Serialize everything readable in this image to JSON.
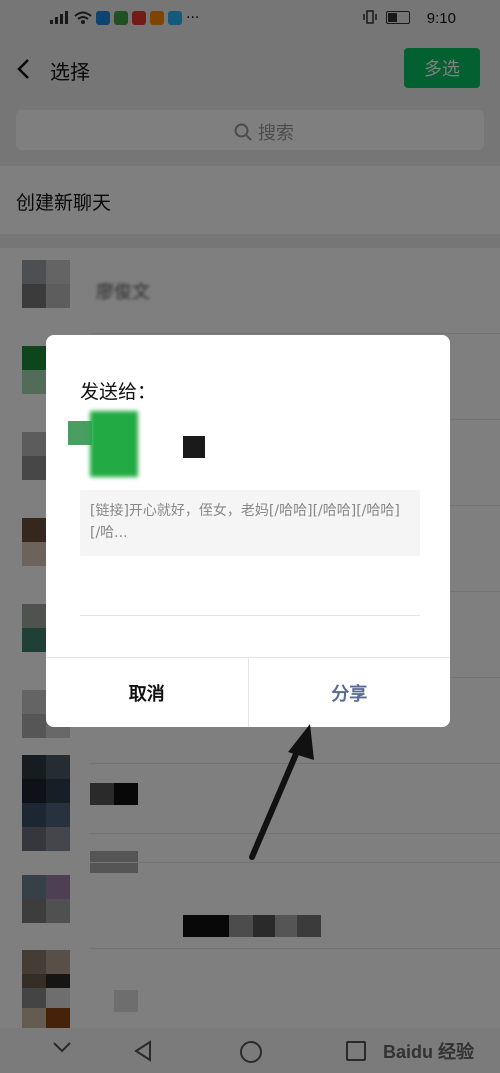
{
  "status_bar": {
    "time": "9:10",
    "more": "···"
  },
  "header": {
    "title": "选择",
    "multi_select": "多选"
  },
  "search": {
    "placeholder": "搜索"
  },
  "new_chat": {
    "label": "创建新聊天"
  },
  "list": {
    "first_item_label": "廖俊文"
  },
  "dialog": {
    "title": "发送给：",
    "preview_text": "[链接]开心就好，侄女，老妈[/哈哈][/哈哈][/哈哈][/哈...",
    "cancel": "取消",
    "share": "分享"
  },
  "watermark": "Baidu 经验",
  "colors": {
    "accent": "#07c160",
    "share_text": "#576b95"
  },
  "icons": [
    "back-icon",
    "search-icon",
    "nav-down-icon",
    "nav-back-icon",
    "nav-home-icon",
    "nav-recent-icon"
  ]
}
